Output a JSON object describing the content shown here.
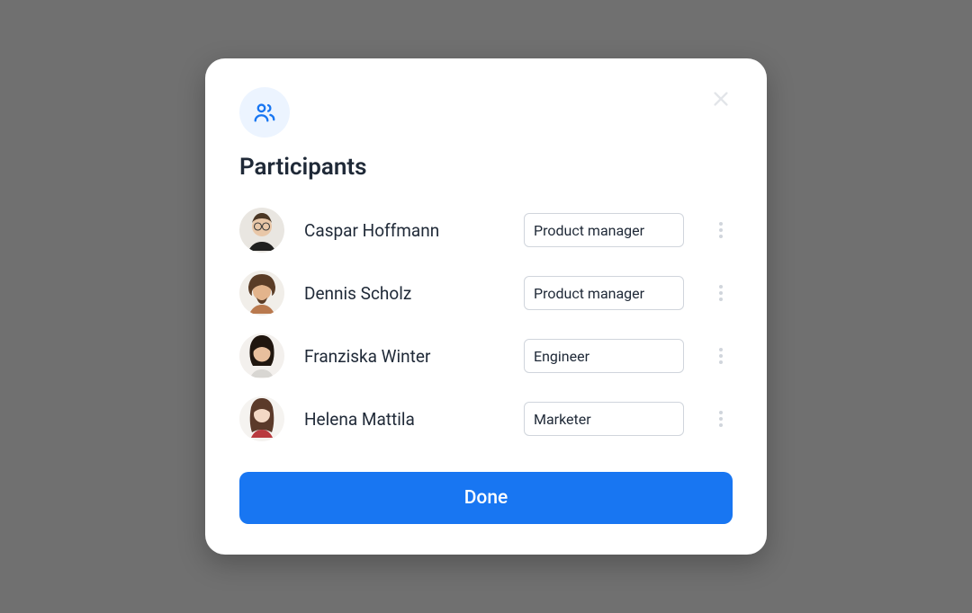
{
  "modal": {
    "title": "Participants",
    "done_label": "Done",
    "colors": {
      "accent": "#1876F2",
      "icon_badge_bg": "#ecf4ff"
    }
  },
  "participants": [
    {
      "name": "Caspar Hoffmann",
      "role": "Product manager"
    },
    {
      "name": "Dennis Scholz",
      "role": "Product manager"
    },
    {
      "name": "Franziska Winter",
      "role": "Engineer"
    },
    {
      "name": "Helena Mattila",
      "role": "Marketer"
    }
  ]
}
